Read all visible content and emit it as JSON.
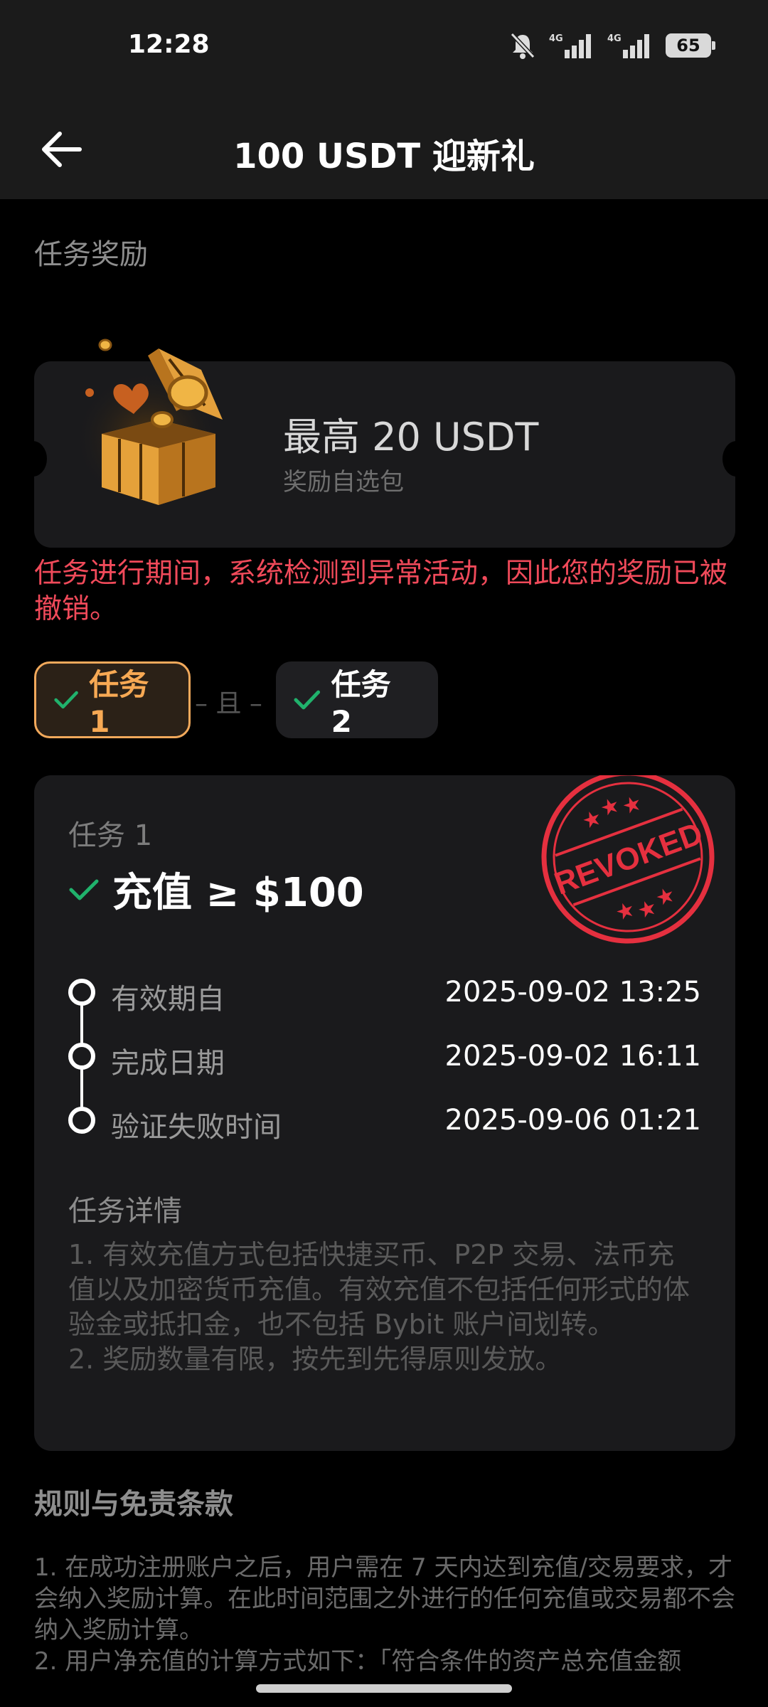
{
  "status": {
    "time": "12:28",
    "network1": "4G",
    "network2": "4G",
    "battery": "65"
  },
  "header": {
    "title": "100 USDT 迎新礼"
  },
  "section_label": "任务奖励",
  "reward": {
    "amount": "最高 20 USDT",
    "subtitle": "奖励自选包"
  },
  "warning": "任务进行期间，系统检测到异常活动，因此您的奖励已被撤销。",
  "tabs": [
    {
      "label": "任务 1",
      "active": true
    },
    {
      "label": "任务 2",
      "active": false
    }
  ],
  "tab_separator": "– 且 –",
  "task": {
    "subtitle": "任务 1",
    "title": "充值 ≥ $100",
    "stamp_text": "REVOKED",
    "timeline": [
      {
        "label": "有效期自",
        "value": "2025-09-02 13:25"
      },
      {
        "label": "完成日期",
        "value": "2025-09-02 16:11"
      },
      {
        "label": "验证失败时间",
        "value": "2025-09-06 01:21"
      }
    ],
    "details_title": "任务详情",
    "details": [
      "1. 有效充值方式包括快捷买币、P2P 交易、法币充值以及加密货币充值。有效充值不包括任何形式的体验金或抵扣金，也不包括 Bybit 账户间划转。",
      "2. 奖励数量有限，按先到先得原则发放。"
    ]
  },
  "rules": {
    "title": "规则与免责条款",
    "items": [
      "1. 在成功注册账户之后，用户需在 7 天内达到充值/交易要求，才会纳入奖励计算。在此时间范围之外进行的任何充值或交易都不会纳入奖励计算。",
      "2. 用户净充值的计算方式如下：「符合条件的资产总充值金额"
    ]
  },
  "colors": {
    "accent": "#f7a954",
    "warning": "#f04a5a",
    "check": "#20b26c",
    "stamp": "#e5303f"
  }
}
